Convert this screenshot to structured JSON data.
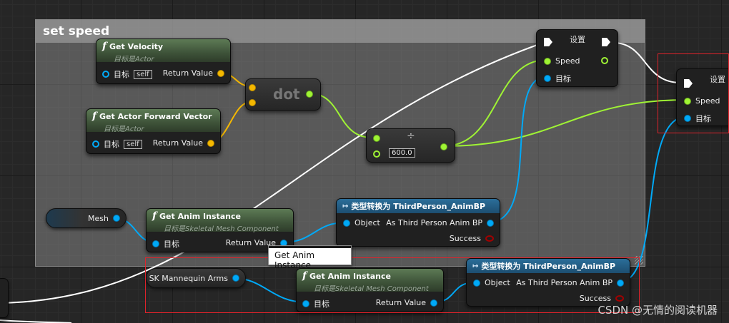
{
  "comment": {
    "title": "set speed"
  },
  "nodes": {
    "get_velocity": {
      "title": "Get Velocity",
      "subtitle": "目标是Actor",
      "target_label": "目标",
      "self": "self",
      "return": "Return Value"
    },
    "get_forward": {
      "title": "Get Actor Forward Vector",
      "subtitle": "目标是Actor",
      "target_label": "目标",
      "self": "self",
      "return": "Return Value"
    },
    "dot": {
      "label": "dot"
    },
    "divide": {
      "symbol": "÷",
      "value": "600.0"
    },
    "set1": {
      "title": "设置",
      "speed": "Speed",
      "target": "目标"
    },
    "set2": {
      "title": "设置",
      "speed": "Speed",
      "target": "目标"
    },
    "mesh_var": {
      "label": "Mesh"
    },
    "get_anim1": {
      "title": "Get Anim Instance",
      "subtitle": "目标是Skeletal Mesh Component",
      "target": "目标",
      "return": "Return Value"
    },
    "cast1": {
      "title": "类型转换为 ThirdPerson_AnimBP",
      "object": "Object",
      "as": "As Third Person Anim BP",
      "success": "Success"
    },
    "sk_var": {
      "label": "SK Mannequin Arms"
    },
    "get_anim2": {
      "title": "Get Anim Instance",
      "subtitle": "目标是Skeletal Mesh Component",
      "target": "目标",
      "return": "Return Value"
    },
    "cast2": {
      "title": "类型转换为 ThirdPerson_AnimBP",
      "object": "Object",
      "as": "As Third Person Anim BP",
      "success": "Success"
    }
  },
  "tooltip": "Get Anim Instance",
  "watermark": "CSDN @无情的阅读机器",
  "colors": {
    "exec": "#ffffff",
    "object": "#00a9f7",
    "vector": "#f5b800",
    "float": "#9ff334",
    "selection": "#e0232b"
  },
  "icons": [
    "function-icon",
    "cast-icon",
    "exec-pin-icon"
  ]
}
